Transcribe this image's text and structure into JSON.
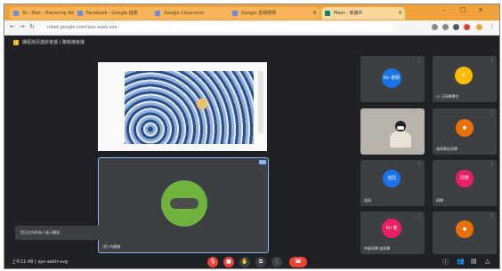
{
  "browser": {
    "tabs": [
      {
        "label": "Yo - Mail - Hierarchy Admin"
      },
      {
        "label": "Facebook - Google 檔案"
      },
      {
        "label": "Google Classroom"
      },
      {
        "label": "Google 雲端硬碟"
      },
      {
        "label": "Meet - 會議中",
        "active": true
      }
    ],
    "url": "meet.google.com/xxx-xxxx-xxx",
    "window_controls": [
      "–",
      "□",
      "×"
    ]
  },
  "meet": {
    "title": "課程資訊連結會議 | 聯絡簿會議",
    "presenting": {
      "type": "slide",
      "image": "wave-painting"
    },
    "self_view": {
      "name": "(您) 的簡報",
      "pin_color": "#8ab4f8"
    },
    "toast": "您正在向所有人展示畫面",
    "meeting_code": "上午11:46 | xpz-aektr-svg",
    "participants": [
      {
        "name": "",
        "avatar_text": "Kn 老師",
        "avatar_color": "#1a73e8"
      },
      {
        "name": "小 王同學學生",
        "avatar_text": "",
        "avatar_color": "#fbbc04",
        "avatar_icon": "crown-icon"
      },
      {
        "name": "",
        "avatar_text": "",
        "video": true
      },
      {
        "name": "吳同學宏同學",
        "avatar_text": "",
        "avatar_color": "#e8710a"
      },
      {
        "name": "浩同",
        "avatar_text": "浩同",
        "avatar_color": "#1a73e8"
      },
      {
        "name": "同學",
        "avatar_text": "同學",
        "avatar_color": "#e91e63"
      },
      {
        "name": "中區同學 宏同學",
        "avatar_text": "Kn 老",
        "avatar_color": "#e91e63"
      },
      {
        "name": "",
        "avatar_text": "",
        "avatar_color": "#e8710a"
      }
    ],
    "controls": {
      "mic": "mic-icon",
      "camera": "camera-icon",
      "hand": "hand-icon",
      "present": "present-icon",
      "more": "more-icon",
      "end": "end-call-icon"
    },
    "right_icons": [
      "info-icon",
      "people-icon",
      "chat-icon",
      "activities-icon"
    ],
    "colors": {
      "accent": "#8ab4f8",
      "danger": "#ea4335",
      "bg": "#202124",
      "tile": "#3c4043"
    }
  }
}
